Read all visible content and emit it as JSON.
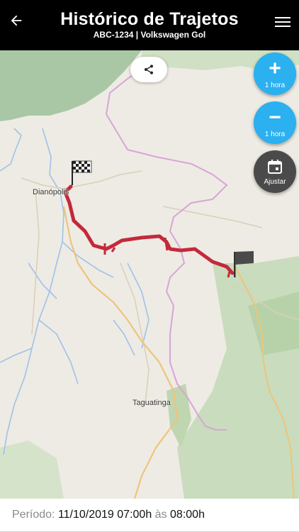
{
  "header": {
    "title": "Histórico de Trajetos",
    "subtitle": "ABC-1234 | Volkswagen Gol",
    "back_icon": "arrow-left-icon",
    "menu_icon": "hamburger-menu-icon"
  },
  "map": {
    "labels": {
      "city_north": "Dianópolis",
      "city_south": "Taguatinga"
    },
    "route_color": "#c4293b",
    "share_icon": "share-icon"
  },
  "controls": {
    "zoom_in": {
      "glyph": "+",
      "label": "1 hora"
    },
    "zoom_out": {
      "glyph": "−",
      "label": "1 hora"
    },
    "adjust": {
      "icon": "calendar-icon",
      "label": "Ajustar"
    },
    "accent_color": "#2bb0f0",
    "adjust_color": "#4a4a4a"
  },
  "footer": {
    "period_label": "Período:",
    "date": "11/10/2019",
    "start_time": "07:00h",
    "separator": "às",
    "end_time": "08:00h"
  }
}
